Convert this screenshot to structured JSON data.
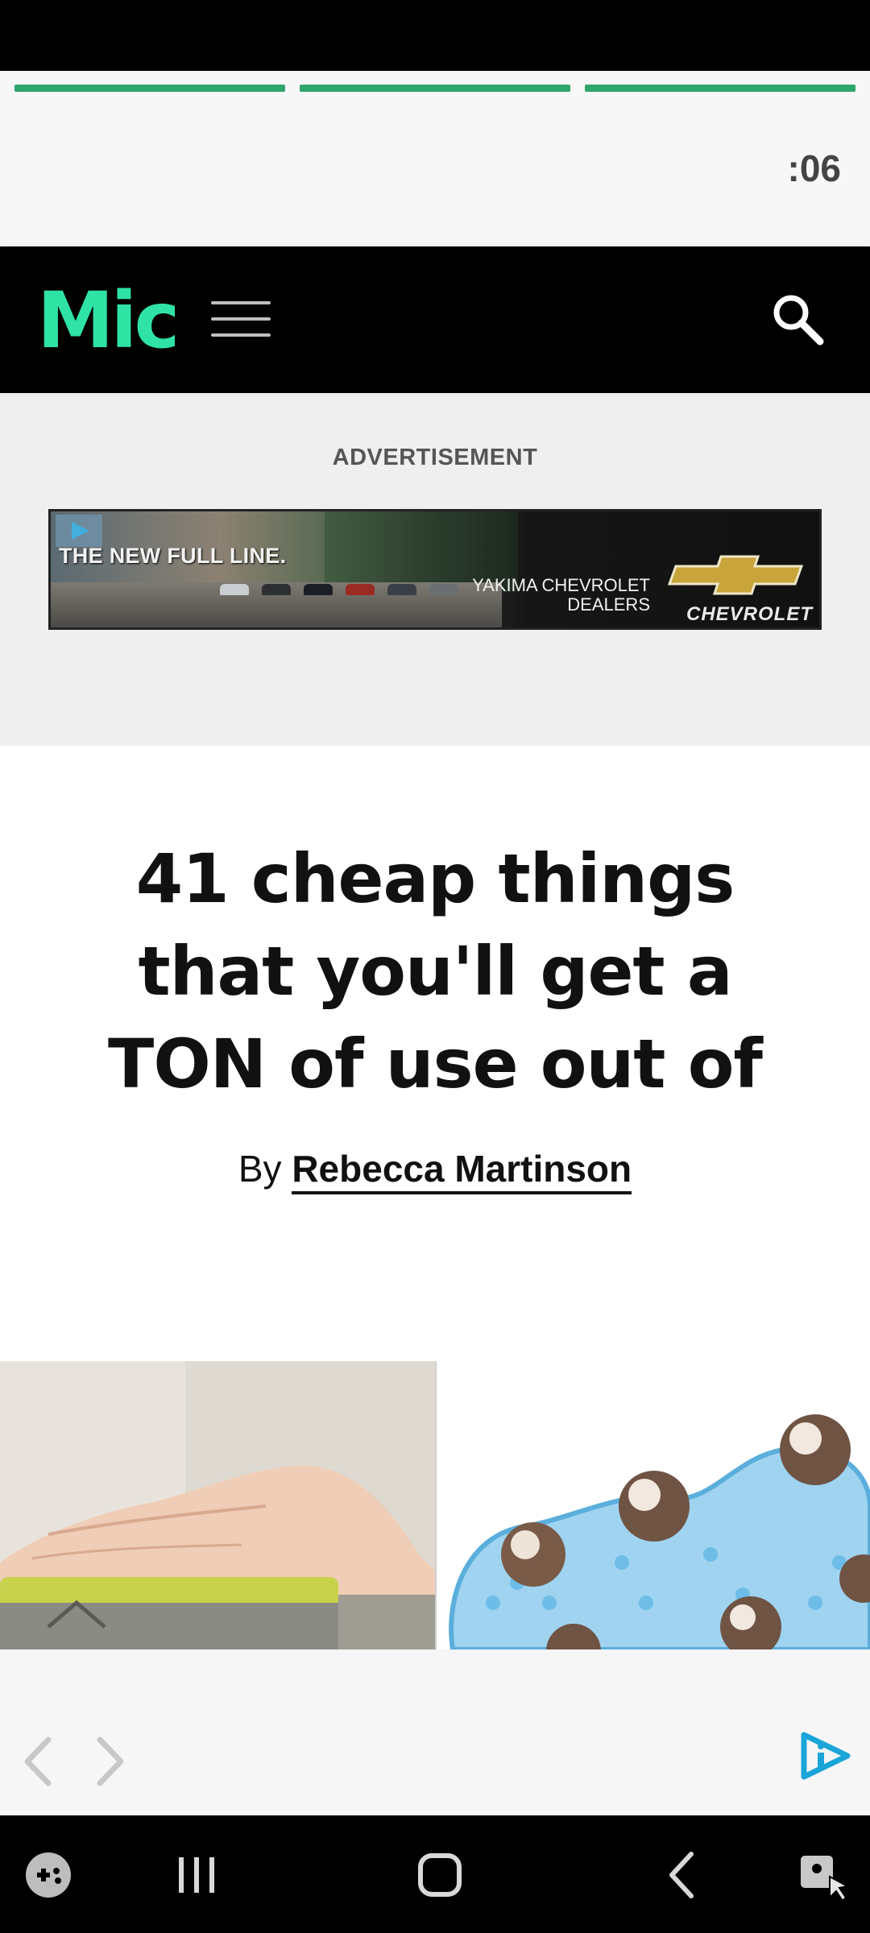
{
  "story": {
    "progress_segments": 3,
    "timer": ":06"
  },
  "header": {
    "logo_text": "Mic",
    "logo_color": "#2fe3a5",
    "menu_icon": "hamburger-menu-icon",
    "search_icon": "search-icon"
  },
  "ad": {
    "label": "ADVERTISEMENT",
    "headline": "THE NEW FULL LINE.",
    "dealer_line1": "YAKIMA CHEVROLET",
    "dealer_line2": "DEALERS",
    "brand": "CHEVROLET"
  },
  "article": {
    "title": "41 cheap things that you'll get a TON of use out of",
    "byline_prefix": "By",
    "author": "Rebecca Martinson"
  },
  "footer": {
    "prev_icon": "chevron-left-icon",
    "next_icon": "chevron-right-icon",
    "brand_icon": "play-info-icon"
  },
  "system_nav": {
    "items": [
      "game-launcher-icon",
      "recent-apps-icon",
      "home-icon",
      "back-icon",
      "accessibility-icon"
    ]
  },
  "colors": {
    "progress": "#2ea56a",
    "header_bg": "#000000",
    "accent": "#1aa5d8"
  }
}
